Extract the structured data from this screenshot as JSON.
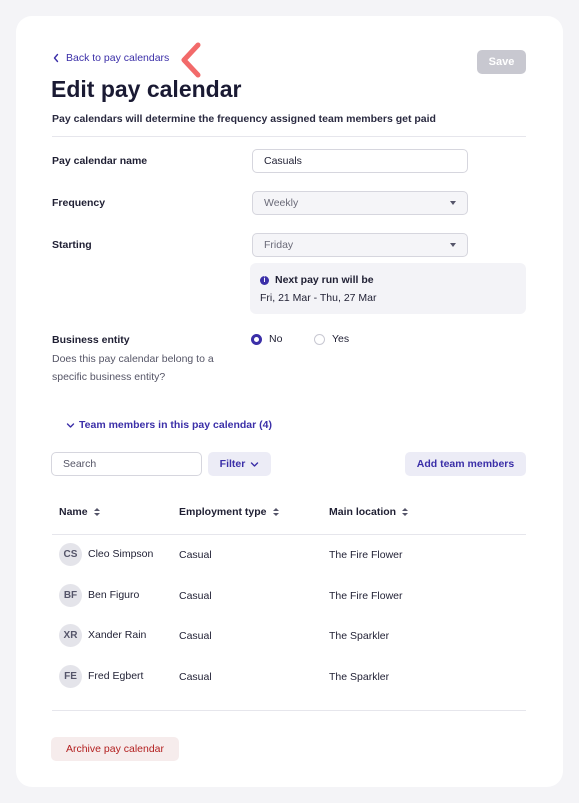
{
  "header": {
    "back_label": "Back to pay calendars",
    "title": "Edit pay calendar",
    "subtitle": "Pay calendars will determine the frequency assigned team members get paid",
    "save_label": "Save"
  },
  "form": {
    "name_label": "Pay calendar name",
    "name_value": "Casuals",
    "frequency_label": "Frequency",
    "frequency_value": "Weekly",
    "starting_label": "Starting",
    "starting_value": "Friday",
    "next_pay_run_title": "Next pay run will be",
    "next_pay_run_value": "Fri, 21 Mar - Thu, 27 Mar",
    "business_entity_label": "Business entity",
    "business_entity_help": "Does this pay calendar belong to a specific business entity?",
    "business_entity_options": [
      "No",
      "Yes"
    ],
    "business_entity_selected": "No"
  },
  "team": {
    "toggle_label": "Team members in this pay calendar (4)",
    "search_placeholder": "Search",
    "filter_label": "Filter",
    "add_label": "Add team members",
    "columns": [
      "Name",
      "Employment type",
      "Main location"
    ],
    "rows": [
      {
        "initials": "CS",
        "name": "Cleo Simpson",
        "type": "Casual",
        "location": "The Fire Flower"
      },
      {
        "initials": "BF",
        "name": "Ben Figuro",
        "type": "Casual",
        "location": "The Fire Flower"
      },
      {
        "initials": "XR",
        "name": "Xander Rain",
        "type": "Casual",
        "location": "The Sparkler"
      },
      {
        "initials": "FE",
        "name": "Fred Egbert",
        "type": "Casual",
        "location": "The Sparkler"
      }
    ]
  },
  "footer": {
    "archive_label": "Archive pay calendar"
  },
  "colors": {
    "accent": "#3b2fa8",
    "danger": "#b32020",
    "annotation": "#f26a6a"
  },
  "icons": {
    "back": "chevron-left-icon",
    "annotation": "red-annotation-arrow-icon",
    "info": "info-icon",
    "select_caret": "caret-down-icon",
    "team_toggle": "chevron-down-icon",
    "filter": "chevron-down-icon",
    "sort": "sort-icon"
  }
}
